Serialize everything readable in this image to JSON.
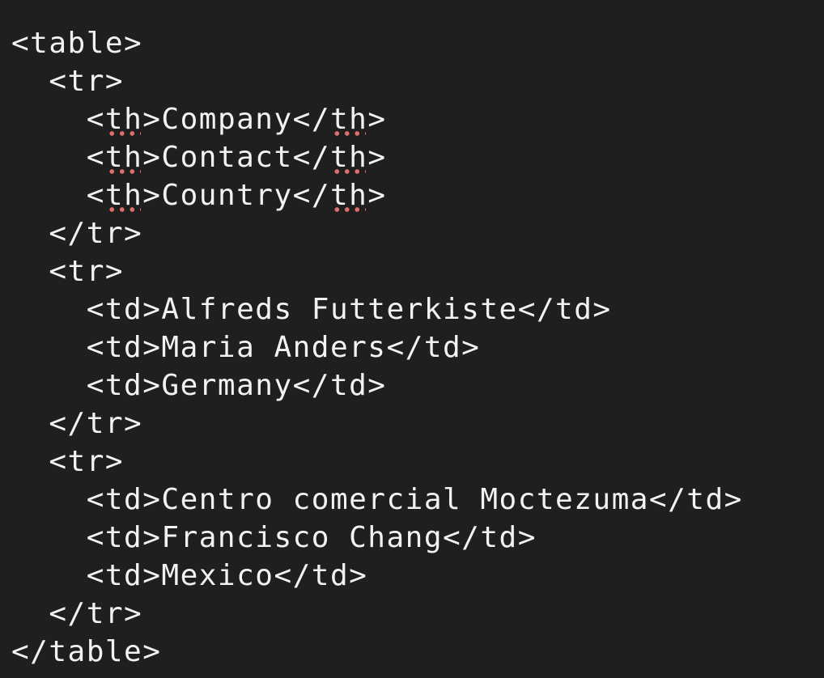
{
  "editor": {
    "theme_background": "#1f1f1f",
    "text_color": "#f2f2f2",
    "spellcheck_underline_color": "#e07070",
    "lines": [
      {
        "indent": "",
        "parts": [
          {
            "text": "<table>"
          }
        ]
      },
      {
        "indent": "  ",
        "parts": [
          {
            "text": "<tr>"
          }
        ]
      },
      {
        "indent": "    ",
        "parts": [
          {
            "text": "<"
          },
          {
            "text": "th",
            "flag": true
          },
          {
            "text": ">Company</"
          },
          {
            "text": "th",
            "flag": true
          },
          {
            "text": ">"
          }
        ]
      },
      {
        "indent": "    ",
        "parts": [
          {
            "text": "<"
          },
          {
            "text": "th",
            "flag": true
          },
          {
            "text": ">Contact</"
          },
          {
            "text": "th",
            "flag": true
          },
          {
            "text": ">"
          }
        ]
      },
      {
        "indent": "    ",
        "parts": [
          {
            "text": "<"
          },
          {
            "text": "th",
            "flag": true
          },
          {
            "text": ">Country</"
          },
          {
            "text": "th",
            "flag": true
          },
          {
            "text": ">"
          }
        ]
      },
      {
        "indent": "  ",
        "parts": [
          {
            "text": "</tr>"
          }
        ]
      },
      {
        "indent": "  ",
        "parts": [
          {
            "text": "<tr>"
          }
        ]
      },
      {
        "indent": "    ",
        "parts": [
          {
            "text": "<td>Alfreds Futterkiste</td>"
          }
        ]
      },
      {
        "indent": "    ",
        "parts": [
          {
            "text": "<td>Maria Anders</td>"
          }
        ]
      },
      {
        "indent": "    ",
        "parts": [
          {
            "text": "<td>Germany</td>"
          }
        ]
      },
      {
        "indent": "  ",
        "parts": [
          {
            "text": "</tr>"
          }
        ]
      },
      {
        "indent": "  ",
        "parts": [
          {
            "text": "<tr>"
          }
        ]
      },
      {
        "indent": "    ",
        "parts": [
          {
            "text": "<td>Centro comercial Moctezuma</td>"
          }
        ]
      },
      {
        "indent": "    ",
        "parts": [
          {
            "text": "<td>Francisco Chang</td>"
          }
        ]
      },
      {
        "indent": "    ",
        "parts": [
          {
            "text": "<td>Mexico</td>"
          }
        ]
      },
      {
        "indent": "  ",
        "parts": [
          {
            "text": "</tr>"
          }
        ]
      },
      {
        "indent": "",
        "parts": [
          {
            "text": "</table>"
          }
        ]
      }
    ]
  }
}
